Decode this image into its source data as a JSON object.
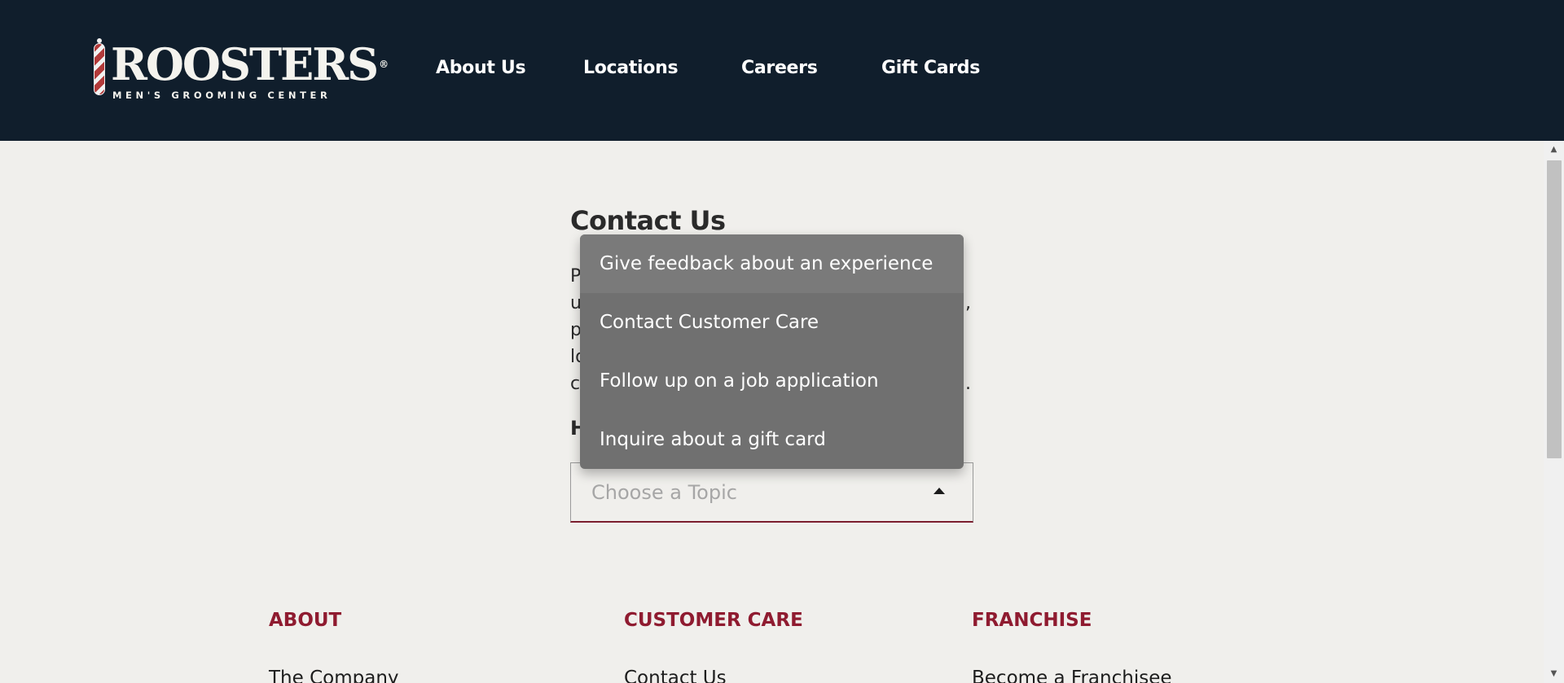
{
  "header": {
    "logo": {
      "word": "ROOSTERS",
      "subtitle": "MEN'S GROOMING CENTER",
      "trademark": "®"
    },
    "nav": [
      {
        "label": "About Us"
      },
      {
        "label": "Locations"
      },
      {
        "label": "Careers"
      },
      {
        "label": "Gift Cards"
      }
    ]
  },
  "main": {
    "title": "Contact Us",
    "body_visible_fragments": [
      "P",
      "u",
      "p",
      "lo",
      "c"
    ],
    "body_trailing_fragments": [
      ",",
      "."
    ],
    "help_label_visible": "H",
    "topic_select": {
      "placeholder": "Choose a Topic",
      "options": [
        {
          "label": "Give feedback about an experience",
          "highlighted": true
        },
        {
          "label": "Contact Customer Care"
        },
        {
          "label": "Follow up on a job application"
        },
        {
          "label": "Inquire about a gift card"
        }
      ]
    }
  },
  "footer": {
    "columns": [
      {
        "heading": "ABOUT",
        "first_link": "The Company"
      },
      {
        "heading": "CUSTOMER CARE",
        "first_link": "Contact Us"
      },
      {
        "heading": "FRANCHISE",
        "first_link": "Become a Franchisee"
      }
    ]
  },
  "colors": {
    "header_bg": "#101e2c",
    "page_bg": "#f0efec",
    "accent": "#8f1b30",
    "dropdown_bg": "#707070"
  }
}
